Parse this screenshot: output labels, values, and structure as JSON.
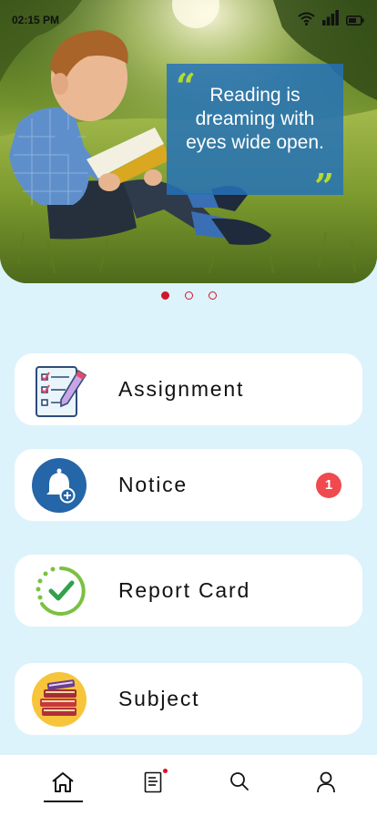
{
  "status_bar": {
    "time": "02:15 PM",
    "icons": [
      "wifi-icon",
      "signal-icon",
      "battery-icon"
    ]
  },
  "banner": {
    "quote": "Reading is dreaming with eyes wide open.",
    "slides": 3,
    "active_slide": 1
  },
  "menu": [
    {
      "label": "Assignment",
      "icon": "assignment-checklist-icon"
    },
    {
      "label": "Notice",
      "icon": "notice-bell-icon",
      "badge": "1"
    },
    {
      "label": "Report Card",
      "icon": "report-card-check-icon"
    },
    {
      "label": "Subject",
      "icon": "subject-books-icon"
    }
  ],
  "bottom_nav": {
    "items": [
      "home-icon",
      "document-icon",
      "search-icon",
      "profile-icon"
    ],
    "active": "home-icon",
    "document_has_notification": true
  },
  "colors": {
    "background": "#dcf3fb",
    "accent_red": "#d4142b",
    "badge": "#f04a4e",
    "quote_box": "#2472b8",
    "quote_marks": "#b5db2e"
  }
}
